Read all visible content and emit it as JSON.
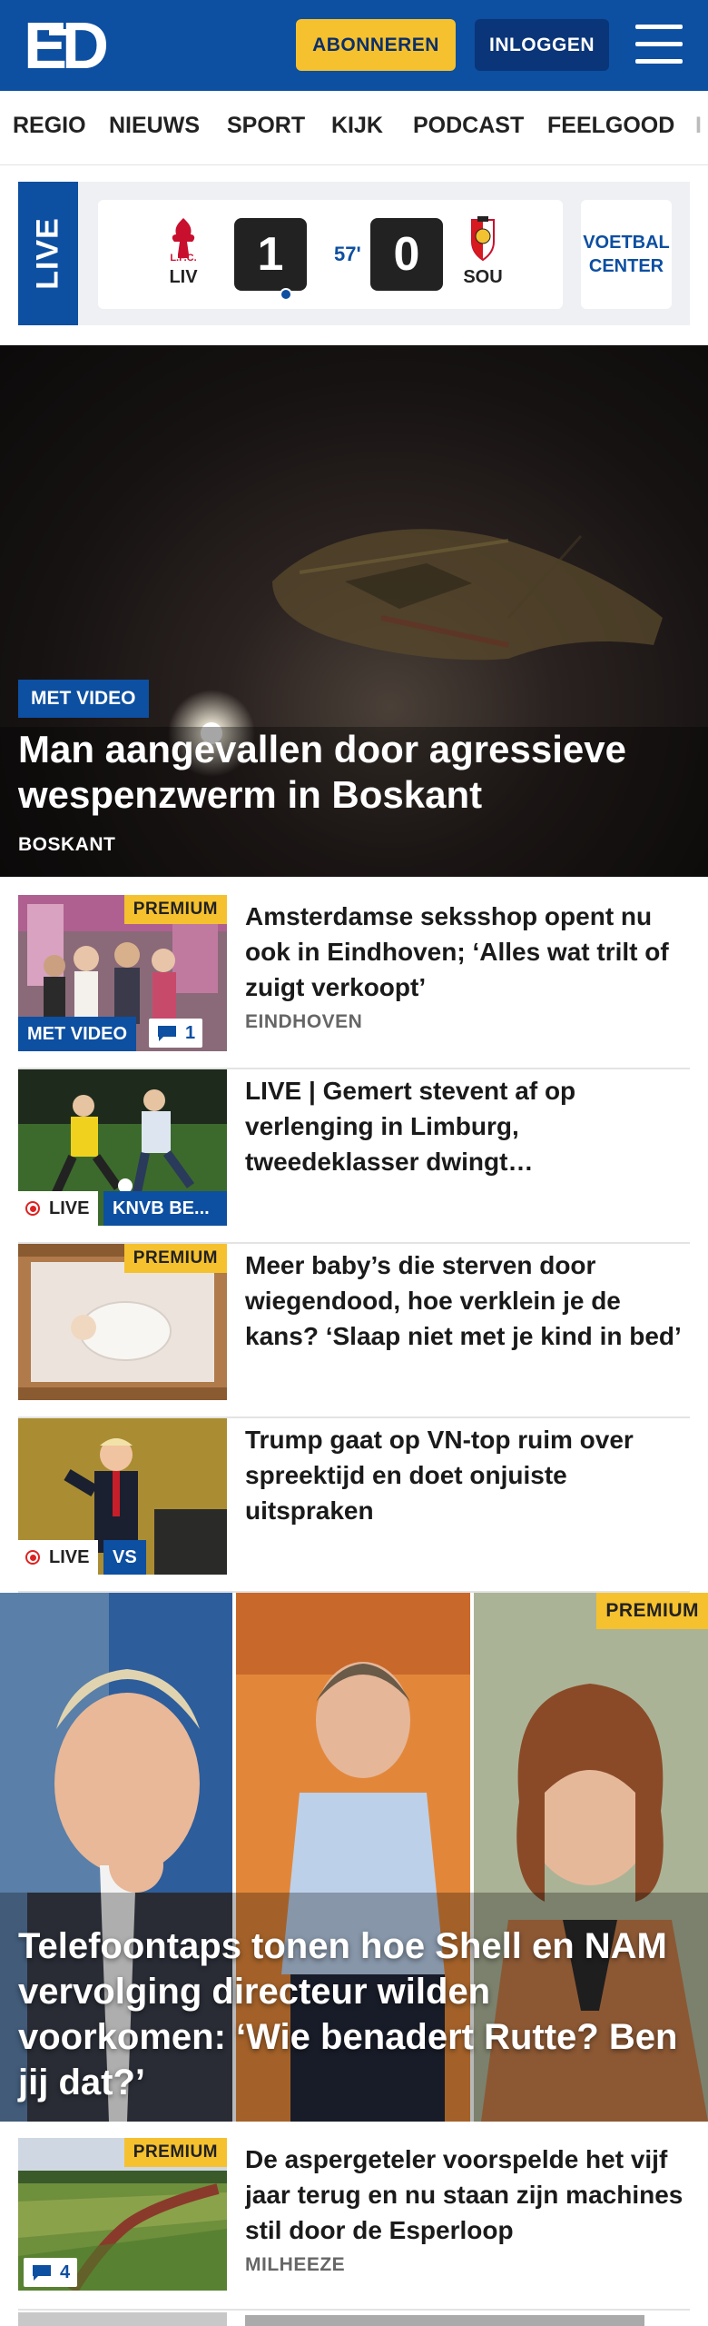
{
  "header": {
    "logo": "ED",
    "subscribe_label": "ABONNEREN",
    "login_label": "INLOGGEN",
    "colors": {
      "brand": "#0d4fa1",
      "accent": "#f5c12e"
    }
  },
  "nav": {
    "items": [
      "REGIO",
      "NIEUWS",
      "SPORT",
      "KIJK",
      "PODCAST",
      "FEELGOOD",
      "I"
    ]
  },
  "livebar": {
    "tab_label": "LIVE",
    "home": {
      "abbr": "LIV",
      "crest_text": "L.F.C."
    },
    "home_score": "1",
    "minute": "57'",
    "away_score": "0",
    "away": {
      "abbr": "SOU"
    },
    "voetbal_center": "VOETBAL CENTER"
  },
  "hero": {
    "tag": "MET VIDEO",
    "title": "Man aangevallen door agressieve wespenzwerm in Boskant",
    "location": "BOSKANT"
  },
  "articles": [
    {
      "title": "Amsterdamse seksshop opent nu ook in Eindhoven; ‘Alles wat trilt of zuigt verkoopt’",
      "location": "EINDHOVEN",
      "premium": "PREMIUM",
      "video_tag": "MET VIDEO",
      "comments": "1"
    },
    {
      "title": "LIVE | Gemert stevent af op verlenging in Limburg, tweedeklasser dwingt derdedivisionist tot verlenging",
      "live_label": "LIVE",
      "category": "KNVB BE..."
    },
    {
      "title": "Meer baby’s die sterven door wiegendood, hoe verklein je de kans? ‘Slaap niet met je kind in bed’",
      "premium": "PREMIUM"
    },
    {
      "title": "Trump gaat op VN-top ruim over spreektijd en doet onjuiste uitspraken",
      "live_label": "LIVE",
      "category": "VS"
    }
  ],
  "feature": {
    "premium": "PREMIUM",
    "title": "Telefoontaps tonen hoe Shell en NAM vervolging directeur wilden voorkomen: ‘Wie benadert Rutte? Ben jij dat?’"
  },
  "last_article": {
    "title": "De aspergeteler voorspelde het vijf jaar terug en nu staan zijn machines stil door de Esperloop",
    "location": "MILHEEZE",
    "premium": "PREMIUM",
    "comments": "4"
  }
}
